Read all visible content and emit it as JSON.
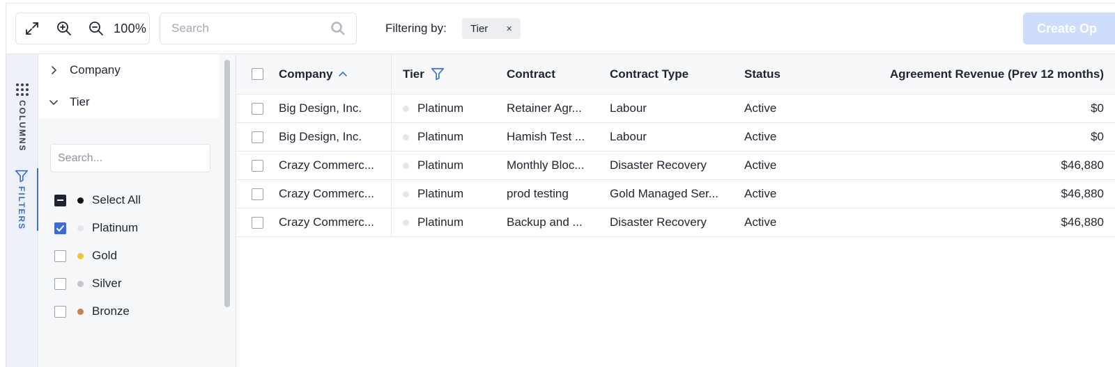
{
  "toolbar": {
    "zoom_level": "100%",
    "search_placeholder": "Search",
    "filtering_label": "Filtering by:",
    "filter_chip": "Tier",
    "chip_close": "×",
    "create_button": "Create Op"
  },
  "side_tabs": {
    "columns": "COLUMNS",
    "filters": "FILTERS"
  },
  "filter_panel": {
    "groups": [
      {
        "label": "Company",
        "expanded": false
      },
      {
        "label": "Tier",
        "expanded": true
      }
    ],
    "search_placeholder": "Search...",
    "options": [
      {
        "label": "Select All",
        "state": "indeterminate",
        "dot_color": "#111111"
      },
      {
        "label": "Platinum",
        "state": "checked",
        "dot_color": "#e4e6ea"
      },
      {
        "label": "Gold",
        "state": "unchecked",
        "dot_color": "#f5c531"
      },
      {
        "label": "Silver",
        "state": "unchecked",
        "dot_color": "#c4c6ca"
      },
      {
        "label": "Bronze",
        "state": "unchecked",
        "dot_color": "#c8854a"
      }
    ]
  },
  "grid": {
    "columns": {
      "company": "Company",
      "tier": "Tier",
      "contract": "Contract",
      "contract_type": "Contract Type",
      "status": "Status",
      "revenue": "Agreement Revenue (Prev 12 months)"
    },
    "rows": [
      {
        "company": "Big Design, Inc.",
        "tier": "Platinum",
        "contract": "Retainer Agr...",
        "contract_type": "Labour",
        "status": "Active",
        "revenue": "$0"
      },
      {
        "company": "Big Design, Inc.",
        "tier": "Platinum",
        "contract": "Hamish Test ...",
        "contract_type": "Labour",
        "status": "Active",
        "revenue": "$0"
      },
      {
        "company": "Crazy Commerc...",
        "tier": "Platinum",
        "contract": "Monthly Bloc...",
        "contract_type": "Disaster Recovery",
        "status": "Active",
        "revenue": "$46,880"
      },
      {
        "company": "Crazy Commerc...",
        "tier": "Platinum",
        "contract": "prod testing",
        "contract_type": "Gold Managed Ser...",
        "status": "Active",
        "revenue": "$46,880"
      },
      {
        "company": "Crazy Commerc...",
        "tier": "Platinum",
        "contract": "Backup and ...",
        "contract_type": "Disaster Recovery",
        "status": "Active",
        "revenue": "$46,880"
      }
    ]
  },
  "colors": {
    "accent": "#3b6ad9",
    "create_button_bg": "#cfdcfb"
  }
}
